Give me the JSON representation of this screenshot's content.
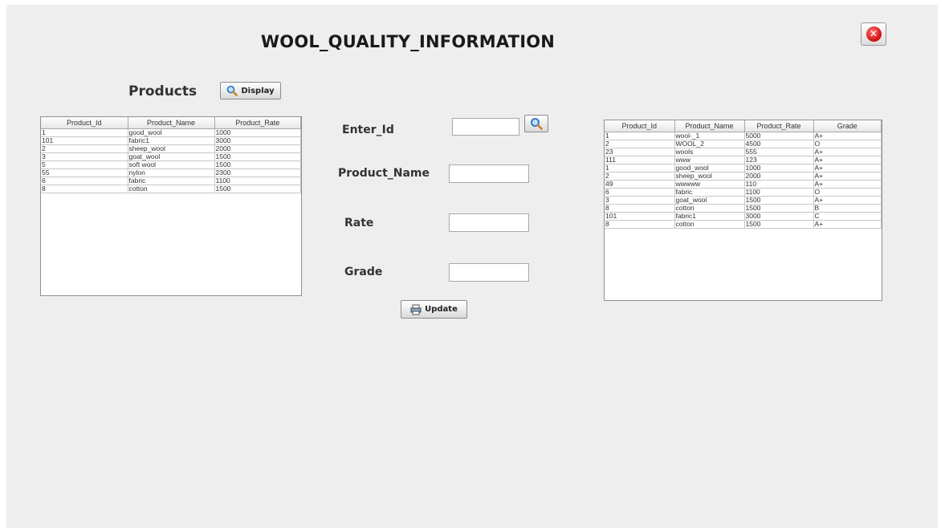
{
  "window": {
    "title": "WOOL_QUALITY_INFORMATION",
    "close_icon": "close-icon"
  },
  "products": {
    "heading": "Products",
    "display_label": "Display",
    "columns": [
      "Product_Id",
      "Product_Name",
      "Product_Rate"
    ],
    "rows": [
      [
        "1",
        "good_wool",
        "1000"
      ],
      [
        "101",
        "fabric1",
        "3000"
      ],
      [
        "2",
        "sheep_wool",
        "2000"
      ],
      [
        "3",
        "goat_wool",
        "1500"
      ],
      [
        "5",
        "soft wool",
        "1500"
      ],
      [
        "55",
        "nylon",
        "2300"
      ],
      [
        "6",
        "fabric",
        "1100"
      ],
      [
        "8",
        "cotton",
        "1500"
      ]
    ]
  },
  "form": {
    "enter_id_label": "Enter_Id",
    "enter_id_value": "",
    "product_name_label": "Product_Name",
    "product_name_value": "",
    "rate_label": "Rate",
    "rate_value": "",
    "grade_label": "Grade",
    "grade_value": "",
    "update_label": "Update"
  },
  "grades": {
    "columns": [
      "Product_Id",
      "Product_Name",
      "Product_Rate",
      "Grade"
    ],
    "rows": [
      [
        "1",
        "wool-_1",
        "5000",
        "A+"
      ],
      [
        "2",
        "WOOL_2",
        "4500",
        "O"
      ],
      [
        "23",
        "wools",
        "555",
        "A+"
      ],
      [
        "111",
        "www",
        "123",
        "A+"
      ],
      [
        "1",
        "good_wool",
        "1000",
        "A+"
      ],
      [
        "2",
        "sheep_wool",
        "2000",
        "A+"
      ],
      [
        "49",
        "wwwww",
        "110",
        "A+"
      ],
      [
        "6",
        "fabric",
        "1100",
        "O"
      ],
      [
        "3",
        "goat_wool",
        "1500",
        "A+"
      ],
      [
        "8",
        "cotton",
        "1500",
        "B"
      ],
      [
        "101",
        "fabric1",
        "3000",
        "C"
      ],
      [
        "8",
        "cotton",
        "1500",
        "A+"
      ]
    ]
  }
}
